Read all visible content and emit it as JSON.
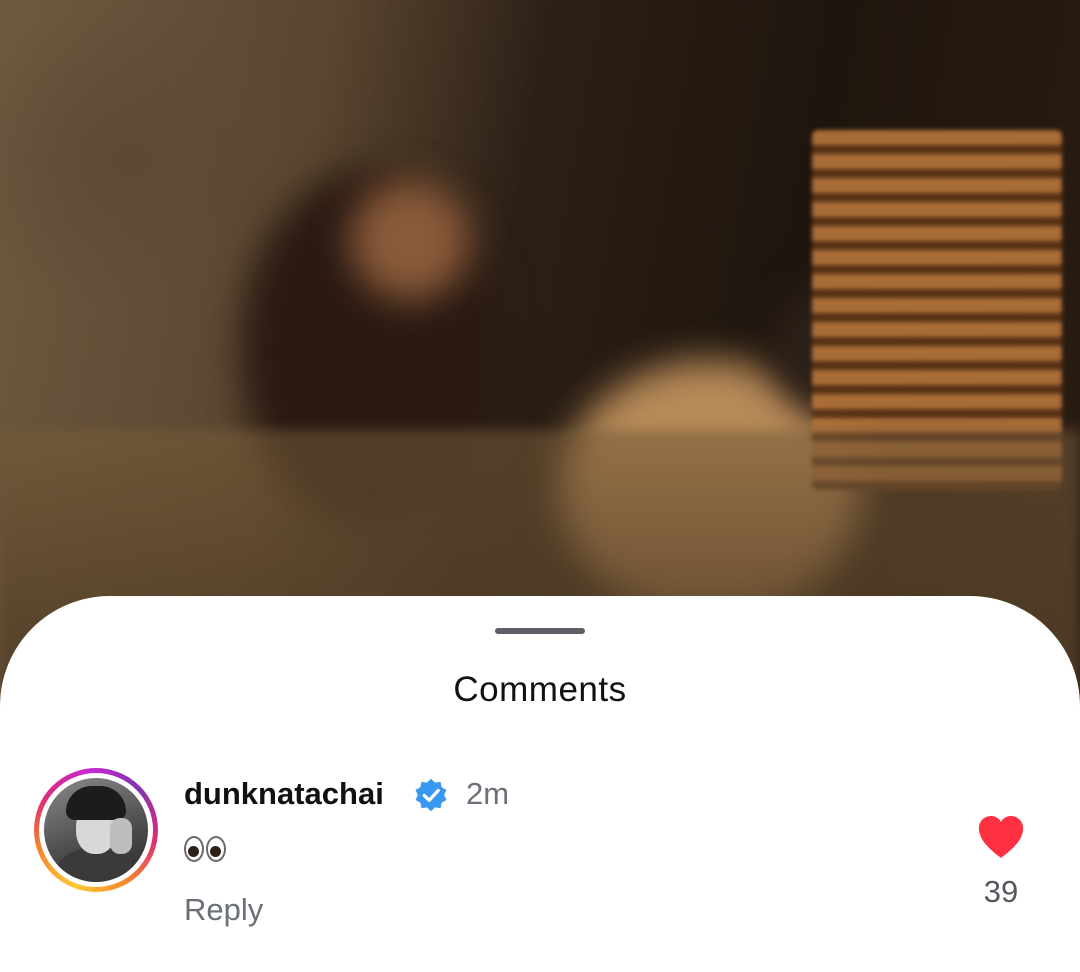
{
  "sheet": {
    "title": "Comments"
  },
  "comment": {
    "username": "dunknatachai",
    "verified": true,
    "time": "2m",
    "text": "👀",
    "reply_label": "Reply",
    "like_count": "39",
    "liked": true
  },
  "colors": {
    "verified_badge": "#3897f0",
    "heart": "#ff3040",
    "secondary_text": "#6b7078"
  },
  "icons": {
    "verified": "verified-badge-icon",
    "like": "heart-icon",
    "handle": "drag-handle"
  }
}
